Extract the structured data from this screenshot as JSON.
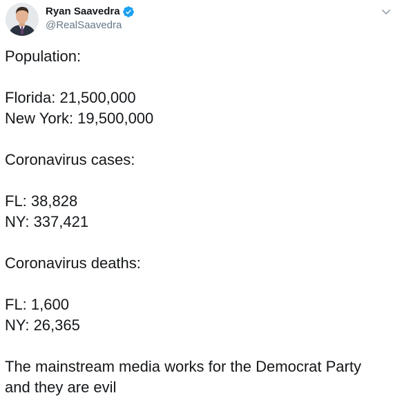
{
  "user": {
    "display_name": "Ryan Saavedra",
    "handle": "@RealSaavedra",
    "verified": true,
    "verified_color": "#1da1f2"
  },
  "icons": {
    "verified": "verified-badge-icon",
    "menu": "chevron-down-icon"
  },
  "tweet": {
    "lines": [
      "Population:",
      "",
      "Florida: 21,500,000",
      "New York: 19,500,000",
      "",
      "Coronavirus cases:",
      "",
      "FL: 38,828",
      "NY: 337,421",
      "",
      "Coronavirus deaths:",
      "",
      "FL: 1,600",
      "NY: 26,365",
      "",
      "The mainstream media works for the Democrat Party",
      "and they are evil"
    ]
  }
}
